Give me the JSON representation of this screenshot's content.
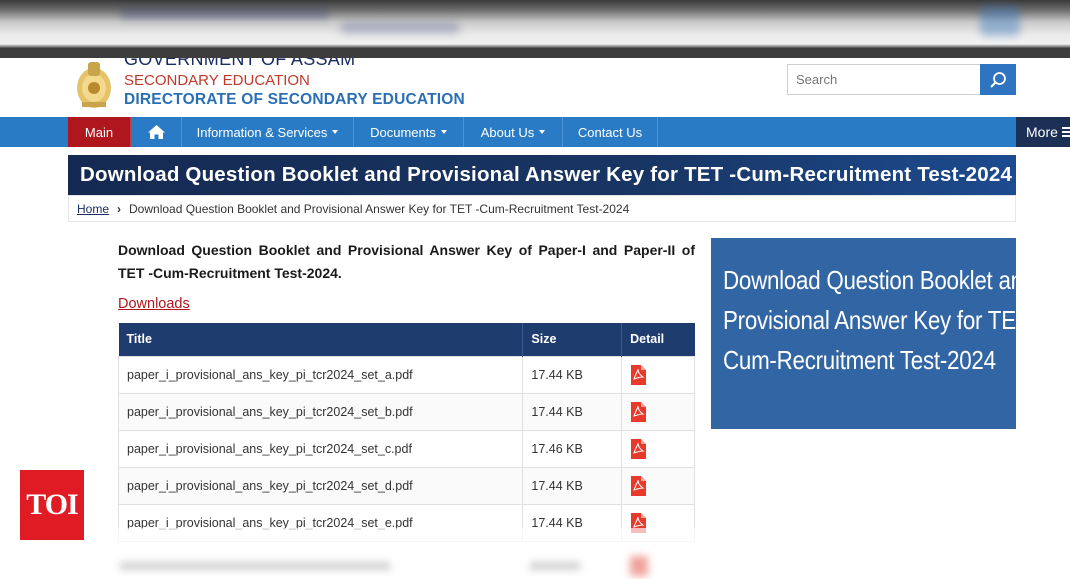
{
  "header": {
    "gov_line": "GOVERNMENT OF ASSAM",
    "sec_line": "SECONDARY EDUCATION",
    "dir_line": "DIRECTORATE OF SECONDARY EDUCATION",
    "search_placeholder": "Search"
  },
  "nav": {
    "main": "Main",
    "info": "Information & Services",
    "documents": "Documents",
    "about": "About Us",
    "contact": "Contact Us",
    "more": "More"
  },
  "page": {
    "title": "Download Question Booklet and Provisional Answer Key for TET -Cum-Recruitment Test-2024",
    "breadcrumb_home": "Home",
    "breadcrumb_current": "Download Question Booklet and Provisional Answer Key for TET -Cum-Recruitment Test-2024",
    "intro": "Download Question Booklet and Provisional Answer Key of Paper-I and Paper-II of TET -Cum-Recruitment Test-2024.",
    "downloads_label": "Downloads"
  },
  "table": {
    "headers": {
      "title": "Title",
      "size": "Size",
      "detail": "Detail"
    },
    "rows": [
      {
        "title": "paper_i_provisional_ans_key_pi_tcr2024_set_a.pdf",
        "size": "17.44 KB"
      },
      {
        "title": "paper_i_provisional_ans_key_pi_tcr2024_set_b.pdf",
        "size": "17.44 KB"
      },
      {
        "title": "paper_i_provisional_ans_key_pi_tcr2024_set_c.pdf",
        "size": "17.46 KB"
      },
      {
        "title": "paper_i_provisional_ans_key_pi_tcr2024_set_d.pdf",
        "size": "17.44 KB"
      },
      {
        "title": "paper_i_provisional_ans_key_pi_tcr2024_set_e.pdf",
        "size": "17.44 KB"
      }
    ]
  },
  "side_image": {
    "line1": "Download Question Booklet and",
    "line2": "Provisional Answer Key for TET -",
    "line3": "Cum-Recruitment Test-2024"
  },
  "watermark": {
    "logo": "TOI"
  },
  "colors": {
    "nav_blue": "#2a7bc6",
    "main_red": "#b0161e",
    "banner_navy": "#152a52",
    "table_header": "#1f3c6e",
    "side_blue": "#3265a3",
    "toi_red": "#e01b24"
  },
  "icons": {
    "home": "home-icon",
    "search": "search-icon",
    "pdf": "pdf-file-icon",
    "menu": "hamburger-icon"
  }
}
